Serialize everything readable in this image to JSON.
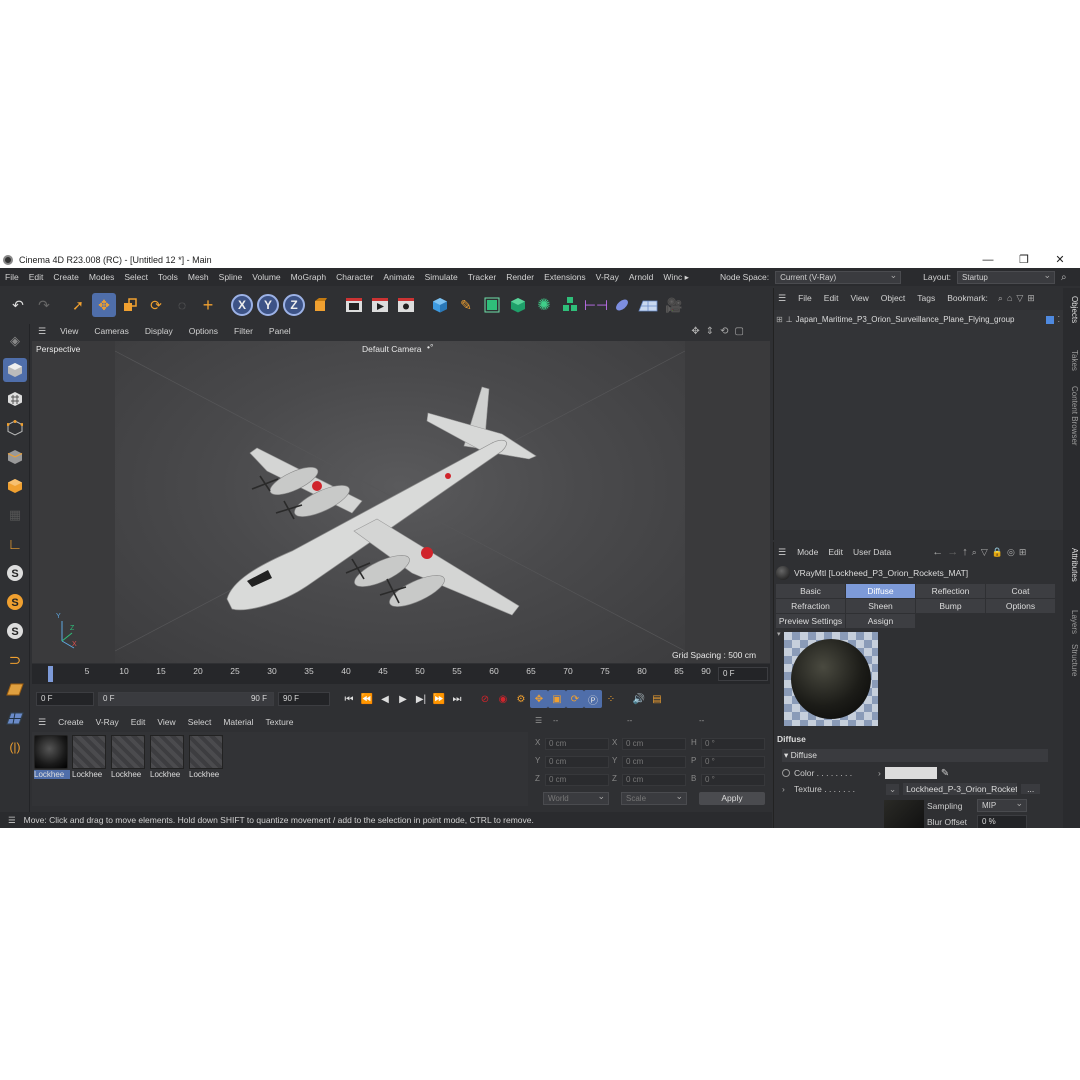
{
  "window": {
    "title": "Cinema 4D R23.008 (RC) - [Untitled 12 *] - Main",
    "minimize": "—",
    "maximize": "❐",
    "close": "✕"
  },
  "menubar": {
    "items": [
      "File",
      "Edit",
      "Create",
      "Modes",
      "Select",
      "Tools",
      "Mesh",
      "Spline",
      "Volume",
      "MoGraph",
      "Character",
      "Animate",
      "Simulate",
      "Tracker",
      "Render",
      "Extensions",
      "V-Ray",
      "Arnold",
      "Winc ▸"
    ],
    "node_space_label": "Node Space:",
    "node_space_value": "Current (V-Ray)",
    "layout_label": "Layout:",
    "layout_value": "Startup"
  },
  "viewport": {
    "menu": [
      "View",
      "Cameras",
      "Display",
      "Options",
      "Filter",
      "Panel"
    ],
    "projection": "Perspective",
    "camera": "Default Camera",
    "camera_suffix": "•°",
    "grid_spacing": "Grid Spacing : 500 cm",
    "axis_y": "Y",
    "axis_z": "Z",
    "axis_x": "X"
  },
  "timeline": {
    "ticks": [
      "0",
      "5",
      "10",
      "15",
      "20",
      "25",
      "30",
      "35",
      "40",
      "45",
      "50",
      "55",
      "60",
      "65",
      "70",
      "75",
      "80",
      "85",
      "90"
    ],
    "current_frame": "0 F",
    "start_frame": "0 F",
    "range_start": "0 F",
    "range_end": "90 F",
    "end_frame": "90 F"
  },
  "materials": {
    "menu": [
      "Create",
      "V-Ray",
      "Edit",
      "View",
      "Select",
      "Material",
      "Texture"
    ],
    "items": [
      "Lockhee",
      "Lockhee",
      "Lockhee",
      "Lockhee",
      "Lockhee"
    ]
  },
  "coordinates": {
    "header_dots": [
      "--",
      "--",
      "--"
    ],
    "rows": [
      {
        "a": "X",
        "av": "0 cm",
        "b": "X",
        "bv": "0 cm",
        "c": "H",
        "cv": "0 °"
      },
      {
        "a": "Y",
        "av": "0 cm",
        "b": "Y",
        "bv": "0 cm",
        "c": "P",
        "cv": "0 °"
      },
      {
        "a": "Z",
        "av": "0 cm",
        "b": "Z",
        "bv": "0 cm",
        "c": "B",
        "cv": "0 °"
      }
    ],
    "space": "World",
    "mode": "Scale",
    "apply": "Apply"
  },
  "status": "Move: Click and drag to move elements. Hold down SHIFT to quantize movement / add to the selection in point mode, CTRL to remove.",
  "object_manager": {
    "menu": [
      "File",
      "Edit",
      "View",
      "Object",
      "Tags",
      "Bookmark:"
    ],
    "objects": [
      "Japan_Maritime_P3_Orion_Surveillance_Plane_Flying_group"
    ]
  },
  "attributes": {
    "menu": [
      "Mode",
      "Edit",
      "User Data"
    ],
    "material_title": "VRayMtl [Lockheed_P3_Orion_Rockets_MAT]",
    "tabs": [
      "Basic",
      "Diffuse",
      "Reflection",
      "Coat",
      "Refraction",
      "Sheen",
      "Bump",
      "Options",
      "Preview Settings",
      "Assign"
    ],
    "active_tab": "Diffuse",
    "section": "Diffuse",
    "group": "▾ Diffuse",
    "color_label": "Color . . . . . . . .",
    "texture_label": "Texture . . . . . . .",
    "texture_value": "Lockheed_P-3_Orion_Rocket",
    "texture_more": "...",
    "sampling_label": "Sampling",
    "sampling_value": "MIP",
    "blur_label": "Blur Offset",
    "blur_value": "0 %"
  },
  "side_tabs": [
    "Objects",
    "Takes",
    "Content Browser",
    "Attributes",
    "Layers",
    "Structure"
  ],
  "colors": {
    "accent": "#4f6eaa",
    "active_tab": "#7d9ad8",
    "panel": "#2f3033",
    "hinomaru": "#d0242b"
  }
}
